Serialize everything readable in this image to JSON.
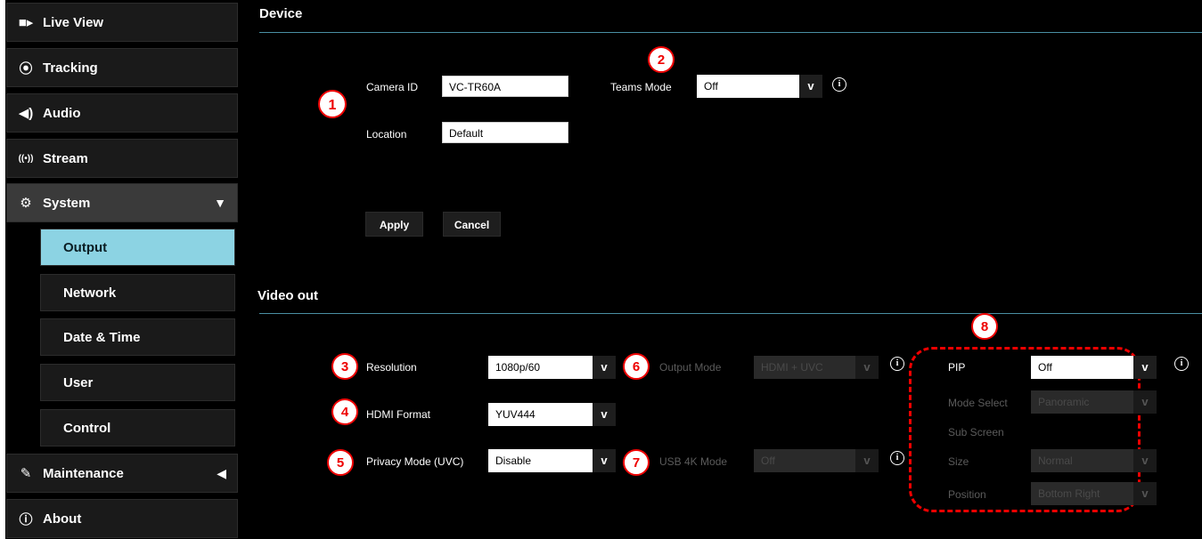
{
  "sidebar": {
    "live_view": "Live View",
    "tracking": "Tracking",
    "audio": "Audio",
    "stream": "Stream",
    "system": "System",
    "system_sub": [
      "Output",
      "Network",
      "Date & Time",
      "User",
      "Control"
    ],
    "maintenance": "Maintenance",
    "about": "About"
  },
  "device": {
    "title": "Device",
    "camera_id_label": "Camera ID",
    "camera_id_value": "VC-TR60A",
    "location_label": "Location",
    "location_value": "Default",
    "teams_mode_label": "Teams Mode",
    "teams_mode_value": "Off",
    "apply": "Apply",
    "cancel": "Cancel"
  },
  "video_out": {
    "title": "Video out",
    "resolution_label": "Resolution",
    "resolution_value": "1080p/60",
    "hdmi_format_label": "HDMI Format",
    "hdmi_format_value": "YUV444",
    "privacy_label": "Privacy Mode (UVC)",
    "privacy_value": "Disable",
    "output_mode_label": "Output Mode",
    "output_mode_value": "HDMI + UVC",
    "usb4k_label": "USB 4K Mode",
    "usb4k_value": "Off"
  },
  "pip": {
    "pip_label": "PIP",
    "pip_value": "Off",
    "mode_select_label": "Mode Select",
    "mode_select_value": "Panoramic",
    "sub_screen_label": "Sub Screen",
    "size_label": "Size",
    "size_value": "Normal",
    "position_label": "Position",
    "position_value": "Bottom Right"
  },
  "callouts": [
    "1",
    "2",
    "3",
    "4",
    "5",
    "6",
    "7",
    "8"
  ],
  "colors": {
    "accent": "#8cd3e3",
    "callout": "#e00000",
    "divider": "#4a8fa3"
  }
}
